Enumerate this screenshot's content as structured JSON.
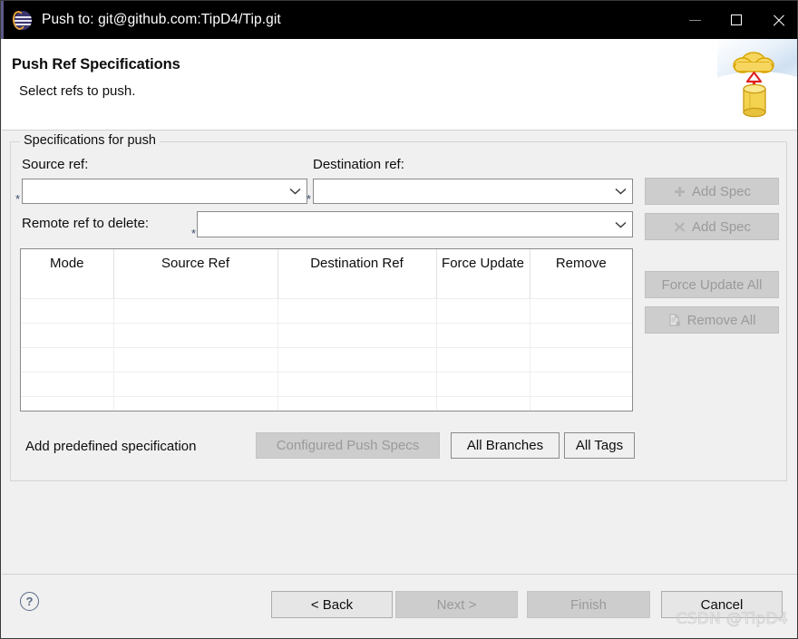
{
  "window": {
    "title": "Push to: git@github.com:TipD4/Tip.git",
    "logo_icon": "eclipse-icon",
    "minimize_icon": "minimize-icon",
    "maximize_icon": "maximize-icon",
    "close_icon": "close-icon"
  },
  "header": {
    "title": "Push Ref Specifications",
    "subtitle": "Select refs to push.",
    "banner_icon": "cloud-upload-database-icon"
  },
  "group": {
    "legend": "Specifications for push",
    "source_ref": {
      "label": "Source ref:",
      "value": "",
      "placeholder": "",
      "required_marker": "*",
      "chevron_icon": "chevron-down-icon"
    },
    "destination_ref": {
      "label": "Destination ref:",
      "value": "",
      "placeholder": "",
      "required_marker": "*",
      "chevron_icon": "chevron-down-icon"
    },
    "remote_ref_delete": {
      "label": "Remote ref to delete:",
      "value": "",
      "placeholder": "",
      "required_marker": "*",
      "chevron_icon": "chevron-down-icon"
    },
    "side_buttons": [
      {
        "label": "Add Spec",
        "icon": "plus-icon",
        "enabled": false
      },
      {
        "label": "Add Spec",
        "icon": "cross-icon",
        "enabled": false
      },
      {
        "label": "Force Update All",
        "icon": "",
        "enabled": false
      },
      {
        "label": "Remove All",
        "icon": "document-remove-icon",
        "enabled": false
      }
    ],
    "table": {
      "columns": [
        "Mode",
        "Source Ref",
        "Destination Ref",
        "Force Update",
        "Remove"
      ],
      "rows": [],
      "empty_row_count": 6
    },
    "predefined": {
      "label": "Add predefined specification",
      "buttons": [
        {
          "label": "Configured Push Specs",
          "enabled": false
        },
        {
          "label": "All Branches",
          "enabled": true
        },
        {
          "label": "All Tags",
          "enabled": true
        }
      ]
    }
  },
  "footer": {
    "help_icon": "help-icon",
    "help_label": "?",
    "buttons": [
      {
        "label": "< Back",
        "enabled": true
      },
      {
        "label": "Next >",
        "enabled": false
      },
      {
        "label": "Finish",
        "enabled": false
      },
      {
        "label": "Cancel",
        "enabled": true
      }
    ],
    "watermark": "CSDN @TipD4"
  },
  "colors": {
    "titlebar_bg": "#000000",
    "dialog_bg": "#f0f0f0",
    "header_bg": "#ffffff",
    "field_border": "#8a8a8a",
    "disabled_bg": "#cdcdcd",
    "disabled_text": "#9a9a9a",
    "accent_star": "#3a4a6a",
    "banner_cloud": "#f2c94c",
    "banner_arrow": "#e02020"
  }
}
